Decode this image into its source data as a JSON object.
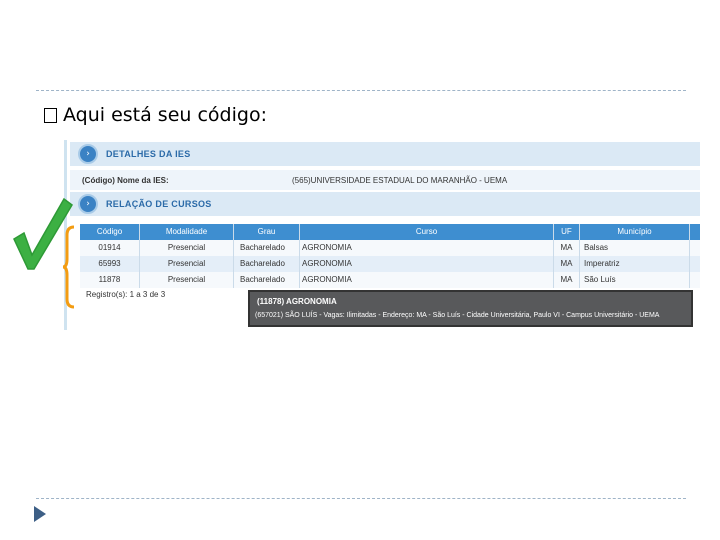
{
  "slide": {
    "bullet_text": "Aqui está seu código:"
  },
  "screenshot": {
    "section1_title": "DETALHES DA IES",
    "ies_label": "(Código) Nome da IES:",
    "ies_value": "(565)UNIVERSIDADE ESTADUAL DO MARANHÃO - UEMA",
    "section2_title": "RELAÇÃO DE CURSOS",
    "table": {
      "headers": [
        "Código",
        "Modalidade",
        "Grau",
        "Curso",
        "UF",
        "Município"
      ],
      "rows": [
        [
          "01914",
          "Presencial",
          "Bacharelado",
          "AGRONOMIA",
          "MA",
          "Balsas"
        ],
        [
          "65993",
          "Presencial",
          "Bacharelado",
          "AGRONOMIA",
          "MA",
          "Imperatriz"
        ],
        [
          "11878",
          "Presencial",
          "Bacharelado",
          "AGRONOMIA",
          "MA",
          "São Luís"
        ]
      ]
    },
    "registros": "Registro(s): 1 a 3 de 3",
    "tooltip": {
      "title": "(11878) AGRONOMIA",
      "body": "(657021) SÃO LUÍS - Vagas: Ilimitadas - Endereço: MA - São Luís - Cidade Universitária, Paulo VI - Campus Universitário - UEMA"
    }
  },
  "colors": {
    "header_blue": "#3e8ed0",
    "section_bg": "#dbe9f5",
    "check_green": "#3cb043",
    "brace_orange": "#f39c12"
  },
  "icons": [
    "section-arrow-icon",
    "checkmark-icon",
    "brace-icon",
    "nav-next-icon"
  ]
}
